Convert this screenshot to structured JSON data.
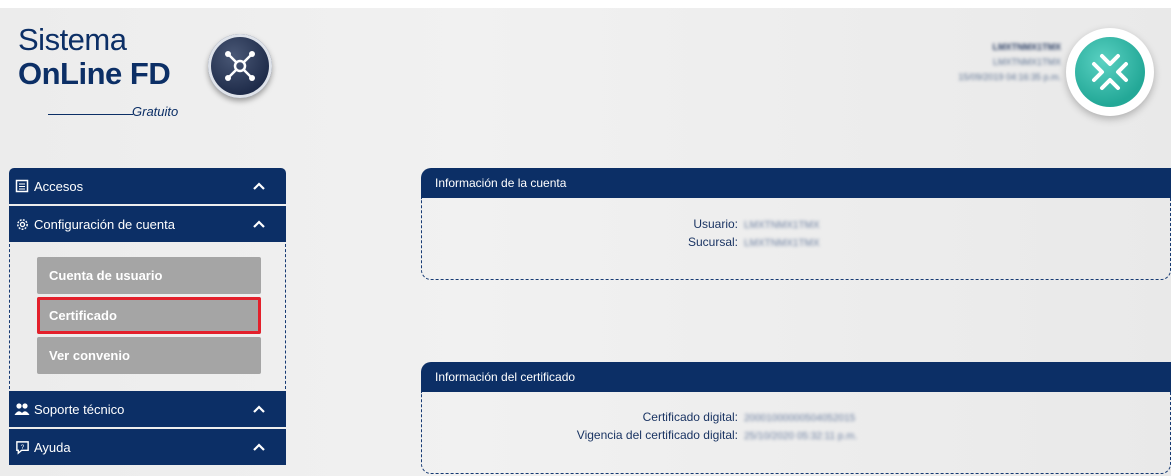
{
  "logo": {
    "line1": "Sistema",
    "line2": "OnLine FD",
    "sub": "Gratuito",
    "badge_icon": "network-hub-icon"
  },
  "user": {
    "name": "LMXTNMX1TMX",
    "account": "LMXTNMX1TMX",
    "timestamp": "15/09/2019 04:16:35 p.m."
  },
  "brand_icon": "x-arrows-icon",
  "sidebar": {
    "sections": [
      {
        "label": "Accesos",
        "icon": "document-icon"
      },
      {
        "label": "Configuración de cuenta",
        "icon": "gear-icon"
      },
      {
        "label": "Soporte técnico",
        "icon": "users-icon"
      },
      {
        "label": "Ayuda",
        "icon": "help-chat-icon"
      }
    ],
    "config_items": [
      "Cuenta de usuario",
      "Certificado",
      "Ver convenio"
    ]
  },
  "account_card": {
    "title": "Información de la cuenta",
    "usuario_label": "Usuario:",
    "usuario_value": "LMXTNMX1TMX",
    "sucursal_label": "Sucursal:",
    "sucursal_value": "LMXTNMX1TMX"
  },
  "cert_card": {
    "title": "Información del certificado",
    "cert_label": "Certificado digital:",
    "cert_value": "20001000000504052015",
    "vig_label": "Vigencia del certificado digital:",
    "vig_value": "25/10/2020 05:32:11 p.m."
  },
  "colors": {
    "navy": "#0c2f66",
    "button_gray": "#a5a5a5",
    "highlight_red": "#e3202b",
    "brand_teal": "#23a897"
  }
}
